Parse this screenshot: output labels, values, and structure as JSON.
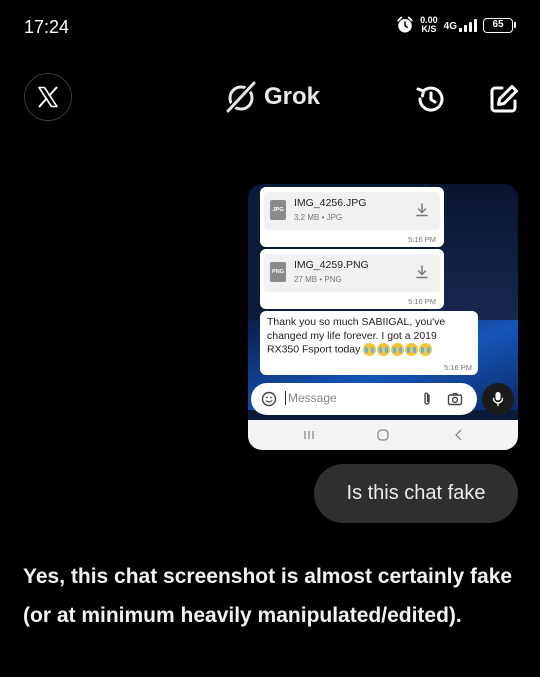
{
  "status_bar": {
    "time": "17:24",
    "net_speed_value": "0.00",
    "net_speed_unit": "K/S",
    "network_type": "4G",
    "battery": "65",
    "icons": [
      "alarm-icon",
      "signal-icon",
      "battery-icon"
    ]
  },
  "header": {
    "title": "Grok",
    "icons": [
      "x-logo-icon",
      "grok-logo-icon",
      "history-icon",
      "new-chat-icon"
    ]
  },
  "attachment": {
    "files": [
      {
        "name": "IMG_4256.JPG",
        "meta": "3.2 MB • JPG",
        "type_label": "JPG",
        "time": "5:16 PM"
      },
      {
        "name": "IMG_4259.PNG",
        "meta": "27 MB • PNG",
        "type_label": "PNG",
        "time": "5:16 PM"
      }
    ],
    "message_text": "Thank you so much SABIIGAL, you've changed my life forever. I got a 2019 RX350 Fsport today",
    "message_time": "5:16 PM",
    "composer_placeholder": "Message"
  },
  "user_message": "Is this chat fake",
  "response_text": "Yes, this chat screenshot is almost certainly fake (or at minimum heavily manipulated/edited)."
}
